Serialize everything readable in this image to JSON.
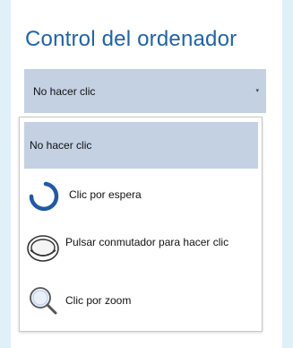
{
  "title": "Control del ordenador",
  "combo": {
    "value": "No hacer clic",
    "arrow": "▾"
  },
  "options": [
    {
      "label": "No hacer clic",
      "icon": "none",
      "selected": true
    },
    {
      "label": "Clic por espera",
      "icon": "dwell-spinner-icon",
      "selected": false
    },
    {
      "label": "Pulsar conmutador para hacer clic",
      "icon": "switch-icon",
      "selected": false
    },
    {
      "label": "Clic por zoom",
      "icon": "magnifier-icon",
      "selected": false
    }
  ],
  "colors": {
    "accent": "#1f63a8",
    "selection": "#c4d1e3",
    "background": "#dff0f8"
  }
}
